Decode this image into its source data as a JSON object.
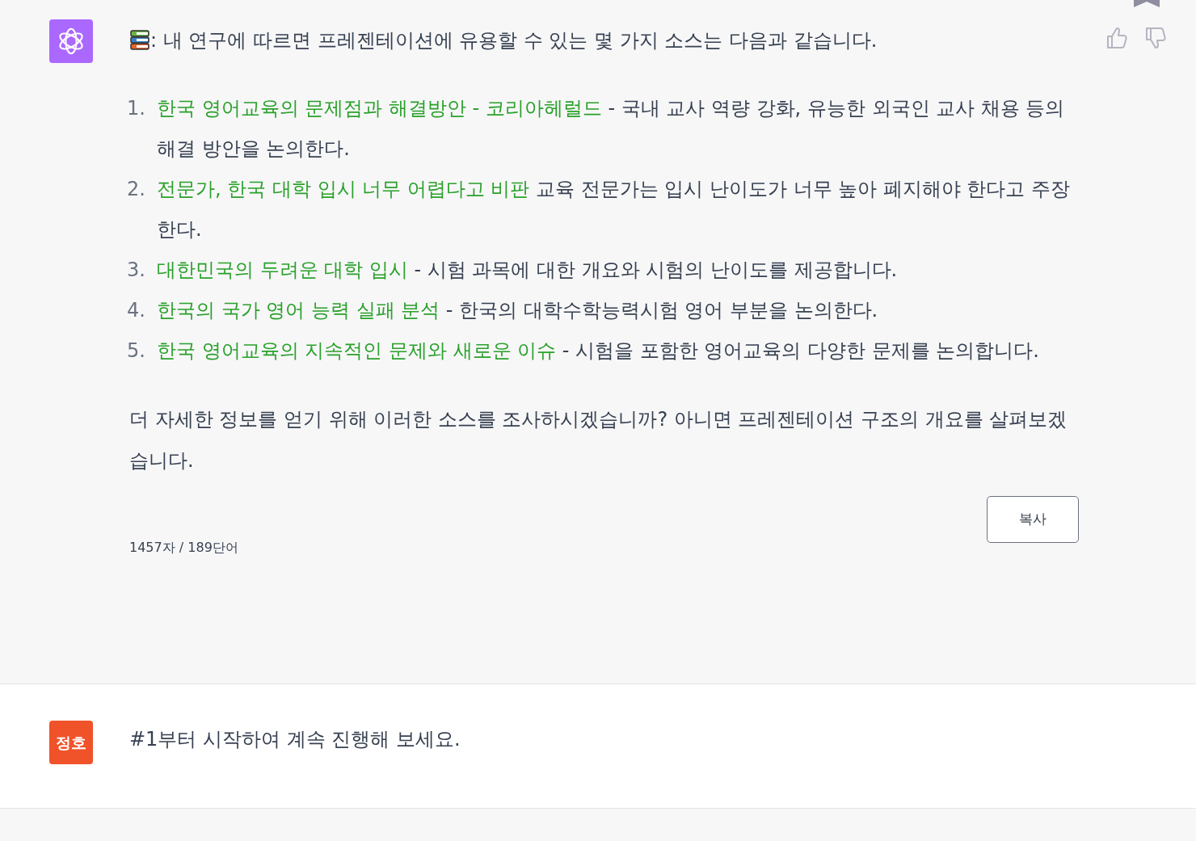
{
  "assistant_message": {
    "intro": ": 내 연구에 따르면 프레젠테이션에 유용할 수 있는 몇 가지 소스는 다음과 같습니다.",
    "sources": [
      {
        "number": "1.",
        "title": "한국 영어교육의 문제점과 해결방안 - 코리아헤럴드",
        "description": "- 국내 교사 역량 강화, 유능한 외국인 교사 채용 등의 해결 방안을 논의한다."
      },
      {
        "number": "2.",
        "title": "전문가, 한국 대학 입시 너무 어렵다고 비판",
        "description": "교육 전문가는 입시 난이도가 너무 높아 폐지해야 한다고 주장한다."
      },
      {
        "number": "3.",
        "title": "대한민국의 두려운 대학 입시",
        "description": "- 시험 과목에 대한 개요와 시험의 난이도를 제공합니다."
      },
      {
        "number": "4.",
        "title": "한국의 국가 영어 능력 실패 분석",
        "description": "- 한국의 대학수학능력시험 영어 부분을 논의한다."
      },
      {
        "number": "5.",
        "title": "한국 영어교육의 지속적인 문제와 새로운 이슈",
        "description": "- 시험을 포함한 영어교육의 다양한 문제를 논의합니다."
      }
    ],
    "closing": "더 자세한 정보를 얻기 위해 이러한 소스를 조사하시겠습니까? 아니면 프레젠테이션 구조의 개요를 살펴보겠습니다.",
    "stats": "1457자 / 189단어",
    "copy_button": "복사"
  },
  "user_message": {
    "avatar_text": "정호",
    "text": "#1부터 시작하여 계속 진행해 보세요."
  }
}
